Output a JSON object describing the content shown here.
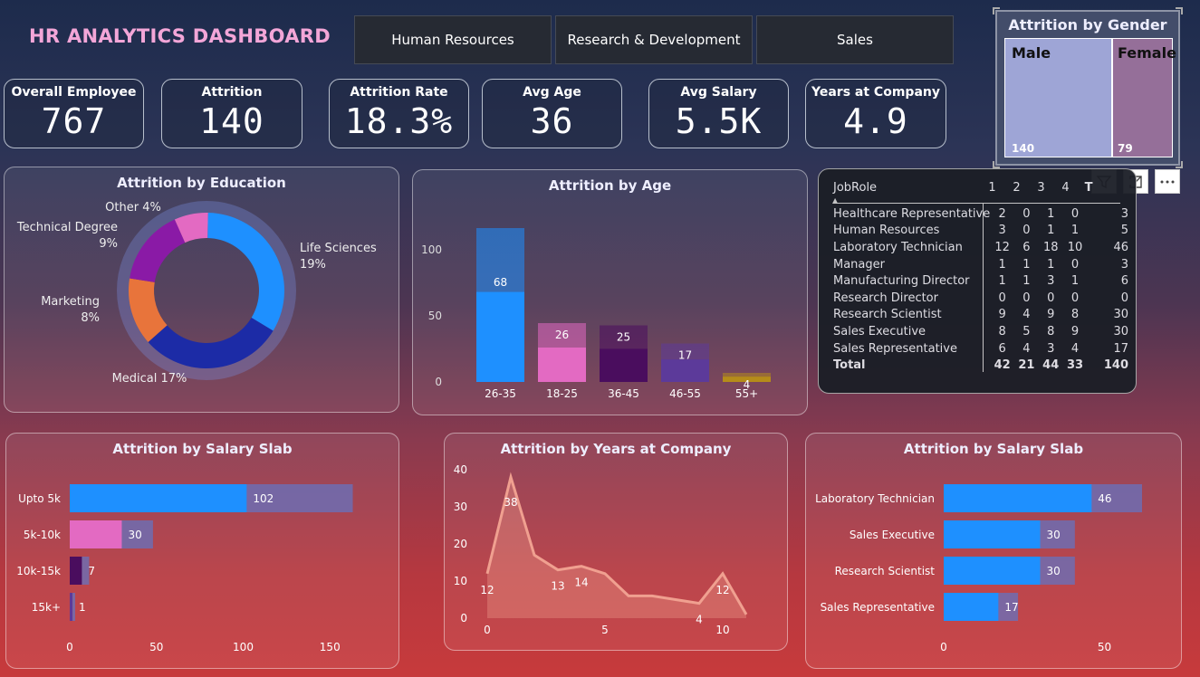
{
  "title": "HR ANALYTICS DASHBOARD",
  "tabs": [
    "Human Resources",
    "Research & Development",
    "Sales"
  ],
  "kpis": [
    {
      "label": "Overall Employee",
      "value": "767"
    },
    {
      "label": "Attrition",
      "value": "140"
    },
    {
      "label": "Attrition Rate",
      "value": "18.3%"
    },
    {
      "label": "Avg Age",
      "value": "36"
    },
    {
      "label": "Avg Salary",
      "value": "5.5K"
    },
    {
      "label": "Years at Company",
      "value": "4.9"
    }
  ],
  "colors": {
    "blue": "#1e90ff",
    "pink": "#e36ac2",
    "purple": "#4a0d5e",
    "violet": "#5c3a9a",
    "gold": "#b58c1a",
    "orange": "#e8743b",
    "navy": "#1c2ba6",
    "magenta": "#8a1aa6",
    "salmon": "#f0a090"
  },
  "chart_data": [
    {
      "type": "pie",
      "title": "Attrition by Education",
      "labels": [
        "Life Sciences",
        "Medical",
        "Marketing",
        "Technical Degree",
        "Other"
      ],
      "label_texts": [
        "Life Sciences\n19%",
        "Medical 17%",
        "Marketing\n8%",
        "Technical Degree\n9%",
        "Other 4%"
      ],
      "values": [
        19,
        17,
        8,
        9,
        4
      ]
    },
    {
      "type": "bar",
      "title": "Attrition by Age",
      "categories": [
        "26-35",
        "18-25",
        "36-45",
        "46-55",
        "55+"
      ],
      "values": [
        68,
        26,
        25,
        17,
        4
      ],
      "yticks": [
        "0",
        "50",
        "100"
      ],
      "ylim": [
        0,
        115
      ]
    },
    {
      "type": "table",
      "title": "JobRole",
      "columns": [
        "1",
        "2",
        "3",
        "4",
        "T"
      ],
      "rows": [
        {
          "role": "Healthcare Representative",
          "v": [
            "2",
            "0",
            "1",
            "0"
          ],
          "t": "3"
        },
        {
          "role": "Human Resources",
          "v": [
            "3",
            "0",
            "1",
            "1"
          ],
          "t": "5"
        },
        {
          "role": "Laboratory Technician",
          "v": [
            "12",
            "6",
            "18",
            "10"
          ],
          "t": "46"
        },
        {
          "role": "Manager",
          "v": [
            "1",
            "1",
            "1",
            "0"
          ],
          "t": "3"
        },
        {
          "role": "Manufacturing Director",
          "v": [
            "1",
            "1",
            "3",
            "1"
          ],
          "t": "6"
        },
        {
          "role": "Research Director",
          "v": [
            "0",
            "0",
            "0",
            "0"
          ],
          "t": "0"
        },
        {
          "role": "Research Scientist",
          "v": [
            "9",
            "4",
            "9",
            "8"
          ],
          "t": "30"
        },
        {
          "role": "Sales Executive",
          "v": [
            "8",
            "5",
            "8",
            "9"
          ],
          "t": "30"
        },
        {
          "role": "Sales Representative",
          "v": [
            "6",
            "4",
            "3",
            "4"
          ],
          "t": "17"
        }
      ],
      "total": {
        "role": "Total",
        "v": [
          "42",
          "21",
          "44",
          "33"
        ],
        "t": "140"
      }
    },
    {
      "type": "bar",
      "title": "Attrition by Gender",
      "categories": [
        "Male",
        "Female"
      ],
      "values": [
        140,
        79
      ]
    },
    {
      "type": "bar",
      "orientation": "horizontal",
      "title": "Attrition by Salary Slab",
      "categories": [
        "Upto 5k",
        "5k-10k",
        "10k-15k",
        "15k+"
      ],
      "values": [
        102,
        30,
        7,
        1
      ],
      "xticks": [
        "0",
        "50",
        "100",
        "150"
      ],
      "xlim": [
        0,
        170
      ]
    },
    {
      "type": "area",
      "title": "Attrition by Years at Company",
      "x": [
        0,
        1,
        2,
        3,
        4,
        5,
        6,
        7,
        8,
        9,
        10,
        11
      ],
      "y": [
        12,
        38,
        17,
        13,
        14,
        12,
        6,
        6,
        5,
        4,
        12,
        1
      ],
      "point_labels": [
        [
          "0",
          "12"
        ],
        [
          "1",
          "38"
        ],
        [
          "3",
          "13"
        ],
        [
          "4",
          "14"
        ],
        [
          "9",
          "4"
        ],
        [
          "10",
          "12"
        ]
      ],
      "xticks": [
        "0",
        "5",
        "10"
      ],
      "yticks": [
        "0",
        "10",
        "20",
        "30",
        "40"
      ],
      "ylim": [
        0,
        44
      ]
    },
    {
      "type": "bar",
      "orientation": "horizontal",
      "title": "Attrition by Salary Slab",
      "categories": [
        "Laboratory Technician",
        "Sales Executive",
        "Research Scientist",
        "Sales Representative"
      ],
      "values": [
        46,
        30,
        30,
        17
      ],
      "xticks": [
        "0",
        "50"
      ],
      "xlim": [
        0,
        57
      ]
    }
  ]
}
